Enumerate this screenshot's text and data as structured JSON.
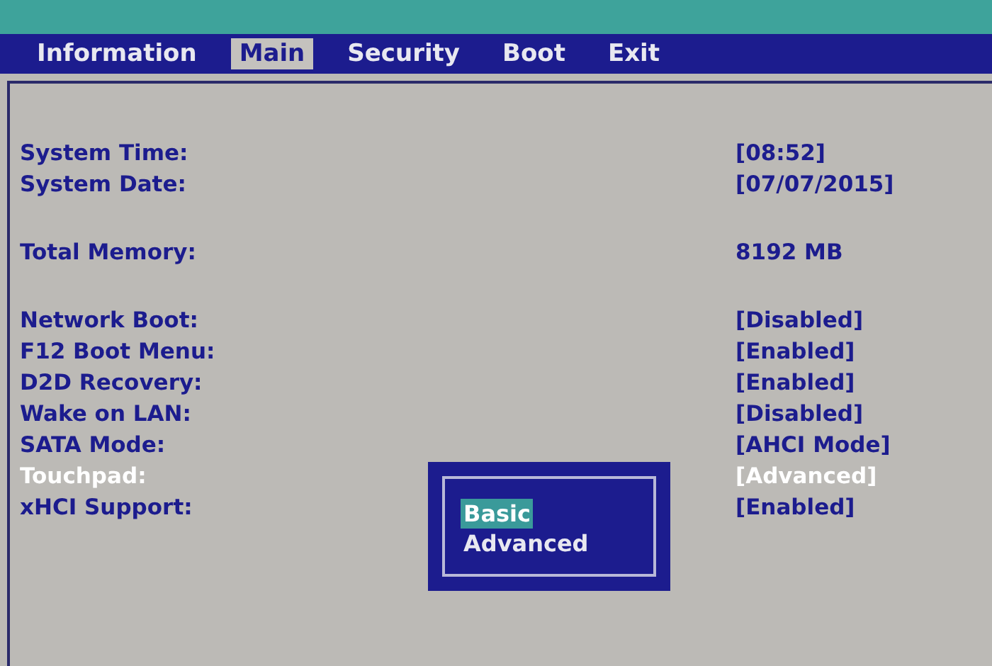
{
  "tabs": [
    {
      "label": "Information",
      "selected": false
    },
    {
      "label": "Main",
      "selected": true
    },
    {
      "label": "Security",
      "selected": false
    },
    {
      "label": "Boot",
      "selected": false
    },
    {
      "label": "Exit",
      "selected": false
    }
  ],
  "groups": [
    [
      {
        "label": "System Time:",
        "value": "[08:52]",
        "selected": false
      },
      {
        "label": "System Date:",
        "value": "[07/07/2015]",
        "selected": false
      }
    ],
    [
      {
        "label": "Total Memory:",
        "value": "8192 MB",
        "selected": false
      }
    ],
    [
      {
        "label": "Network Boot:",
        "value": "[Disabled]",
        "selected": false
      },
      {
        "label": "F12 Boot Menu:",
        "value": "[Enabled]",
        "selected": false
      },
      {
        "label": "D2D Recovery:",
        "value": "[Enabled]",
        "selected": false
      },
      {
        "label": "Wake on LAN:",
        "value": "[Disabled]",
        "selected": false
      },
      {
        "label": "SATA Mode:",
        "value": "[AHCI Mode]",
        "selected": false
      },
      {
        "label": "Touchpad:",
        "value": "[Advanced]",
        "selected": true
      },
      {
        "label": "xHCI Support:",
        "value": "[Enabled]",
        "selected": false
      }
    ]
  ],
  "popup": {
    "options": [
      {
        "label": "Basic",
        "selected": true
      },
      {
        "label": "Advanced",
        "selected": false
      }
    ]
  }
}
